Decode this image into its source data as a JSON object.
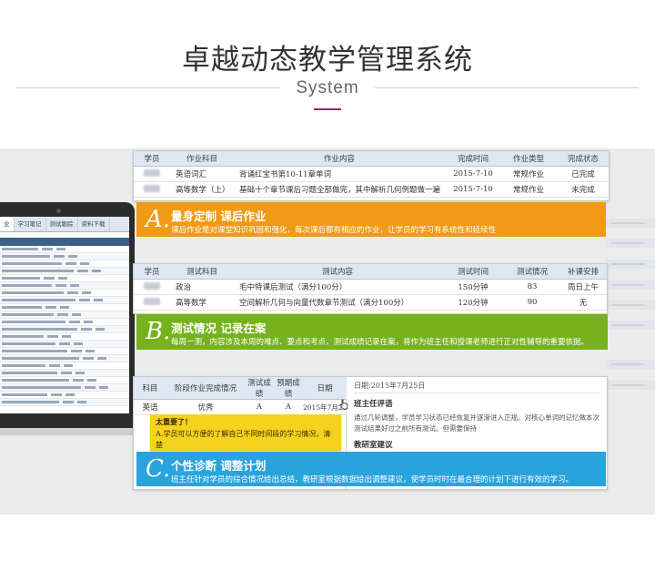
{
  "header": {
    "title": "卓越动态教学管理系统",
    "subtitle": "System"
  },
  "laptop": {
    "tabs": [
      "业",
      "学习笔记",
      "测试跟踪",
      "资料下载"
    ]
  },
  "homework_table": {
    "columns": [
      "学员",
      "作业科目",
      "作业内容",
      "完成时间",
      "作业类型",
      "完成状态"
    ],
    "rows": [
      {
        "subject": "英语词汇",
        "content": "背诵红宝书第10-11章单词",
        "time": "2015-7-10",
        "type": "常规作业",
        "status": "已完成"
      },
      {
        "subject": "高等数学（上）",
        "content": "基础十个章节课后习题全部做完，其中解析几何例题做一遍",
        "time": "2015-7-10",
        "type": "常规作业",
        "status": "未完成"
      }
    ]
  },
  "banner_a": {
    "letter": "A.",
    "heading": "量身定制 课后作业",
    "description": "课后作业是对课堂知识巩固和强化，每次课后都有相应的作业，让学员的学习有系统性和延续性"
  },
  "test_table": {
    "columns": [
      "学员",
      "测试科目",
      "测试内容",
      "测试时间",
      "测试情况",
      "补课安排"
    ],
    "rows": [
      {
        "subject": "政治",
        "content": "毛中特课后测试（满分100分）",
        "time": "150分钟",
        "score": "83",
        "plan": "周日上午"
      },
      {
        "subject": "高等数学",
        "content": "空间解析几何与向量代数章节测试（满分100分）",
        "time": "120分钟",
        "score": "90",
        "plan": "无"
      }
    ]
  },
  "banner_b": {
    "letter": "B.",
    "heading": "测试情况 记录在案",
    "description": "每周一测，内容涉及本周的难点、要点和考点，测试成绩记录在案，将作为班主任和授课老师进行正对性辅导的重要依据。"
  },
  "diagnosis_table": {
    "columns": [
      "科目",
      "阶段作业完成情况",
      "测试成绩",
      "预期成绩",
      "日期"
    ],
    "rows": [
      {
        "subject": "英语",
        "completion": "优秀",
        "score": "A",
        "expected": "A",
        "date": "2015年7月25日"
      }
    ]
  },
  "diagnosis_panel": {
    "date": "日期:2015年7月25日",
    "comment_heading": "班主任评语",
    "comment": "通过几轮调整，学员学习状态已经恢复并逐渐进入正规。对核心单词的记忆做本次测试结果好过之前所有测试。但需要保持",
    "advice_heading": "教研室建议"
  },
  "sticky_note": {
    "title": "太重要了！",
    "body": "A.学员可以方便的了解自己不同时间段的学习情况，清楚"
  },
  "banner_c": {
    "letter": "C.",
    "heading": "个性诊断 调整计划",
    "description": "班主任针对学员的综合情况给出总结，教研室根据数据给出调整建议，使学员时时在最合理的计划下进行有效的学习。"
  },
  "colors": {
    "accent": "#8e2a6e",
    "banner_a": "#f09a16",
    "banner_b": "#76b21e",
    "banner_c": "#2aa3dc",
    "note": "#f5d21e"
  }
}
